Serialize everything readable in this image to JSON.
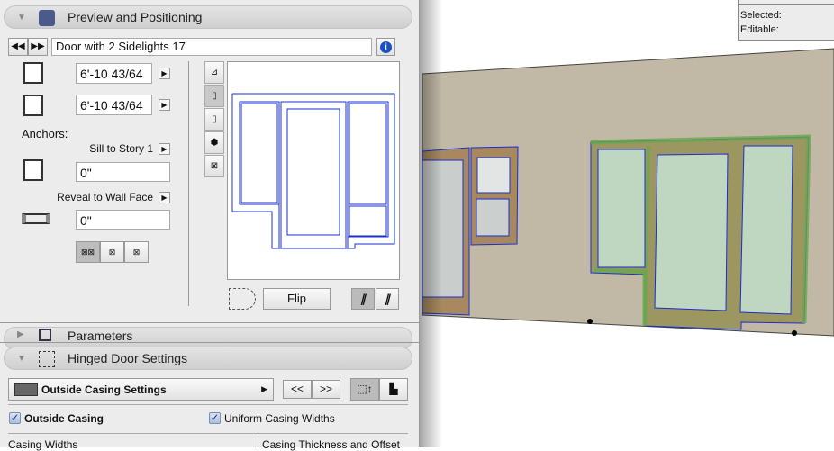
{
  "preview_panel": {
    "title": "Preview and Positioning",
    "object_name": "Door with 2 Sidelights 17",
    "width_value": "6'-10 43/64",
    "height_value": "6'-10 43/64",
    "anchors_label": "Anchors:",
    "sill_anchor": "Sill to Story 1",
    "sill_value": "0\"",
    "reveal_anchor": "Reveal to Wall Face",
    "reveal_value": "0\"",
    "flip_label": "Flip"
  },
  "parameters_panel": {
    "title": "Parameters"
  },
  "hinged_panel": {
    "title": "Hinged Door Settings",
    "page_select": "Outside Casing Settings",
    "prev_label": "<<",
    "next_label": ">>",
    "outside_casing": {
      "label": "Outside Casing",
      "checked": true
    },
    "uniform_widths": {
      "label": "Uniform Casing Widths",
      "checked": true
    },
    "casing_widths_label": "Casing Widths",
    "casing_thickness_label": "Casing Thickness and Offset"
  },
  "info_box": {
    "selected_label": "Selected:",
    "editable_label": "Editable:"
  },
  "colors": {
    "wall": "#c1b9a6",
    "frame": "#a8895f",
    "glass": "#bfd6c0",
    "selection": "#6aa84f",
    "outline": "#1a2fd0"
  }
}
